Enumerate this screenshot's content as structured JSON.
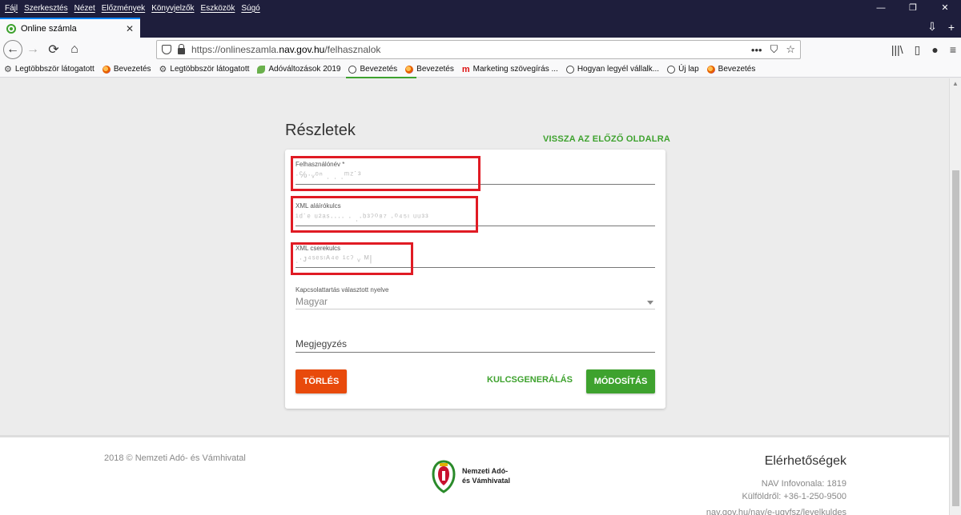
{
  "menu": {
    "items": [
      "Fájl",
      "Szerkesztés",
      "Nézet",
      "Előzmények",
      "Könyvjelzők",
      "Eszközök",
      "Súgó"
    ]
  },
  "window_controls": {
    "minimize": "—",
    "restore": "❐",
    "close": "✕"
  },
  "tab": {
    "title": "Online számla",
    "close": "✕"
  },
  "tabstrip_actions": {
    "overflow": "⇩",
    "new_tab": "+"
  },
  "nav": {
    "back": "←",
    "forward": "→",
    "reload": "⟳",
    "home": "⌂",
    "url_prefix": "https://onlineszamla.",
    "url_host": "nav.gov.hu",
    "url_path": "/felhasznalok",
    "url_more": "•••",
    "url_pocket": "⛉",
    "url_star": "☆",
    "library": "|||\\",
    "sidebar": "▯",
    "account": "●",
    "menu": "≡"
  },
  "bookmarks": [
    {
      "label": "Legtöbbször látogatott",
      "icon": "gear-icon"
    },
    {
      "label": "Bevezetés",
      "icon": "firefox-icon"
    },
    {
      "label": "Legtöbbször látogatott",
      "icon": "gear-icon"
    },
    {
      "label": "Adóváltozások 2019",
      "icon": "leaf-icon"
    },
    {
      "label": "Bevezetés",
      "icon": "globe-icon"
    },
    {
      "label": "Bevezetés",
      "icon": "firefox-icon"
    },
    {
      "label": "Marketing szövegírás ...",
      "icon": "m-icon"
    },
    {
      "label": "Hogyan legyél vállalk...",
      "icon": "globe-icon"
    },
    {
      "label": "Új lap",
      "icon": "globe-icon"
    },
    {
      "label": "Bevezetés",
      "icon": "firefox-icon"
    }
  ],
  "page": {
    "title": "Részletek",
    "back_link": "VISSZA AZ ELŐZŐ OLDALRA"
  },
  "form": {
    "username": {
      "label": "Felhasználónév *",
      "value": "·℅·ᵥᵒⁿ ˌ ˌ ˌᵐᶻ˙³"
    },
    "xml_sign_key": {
      "label": "XML aláírókulcs",
      "value": "¹ᵈ˙ᵉ ᵘ²ᵃˢ···· · ˌ·ᵇ³ˀ⁰⁸⁷ ·⁰⁴⁵ᶦ ᵘᵘ³³"
    },
    "xml_exchange_key": {
      "label": "XML cserekulcs",
      "value": "ˌ·ᴊ⁴ˢᵉˢᶦᴬ⁴ᵉ ¹ᶜˀ ᵥ ᴹ|"
    },
    "language": {
      "label": "Kapcsolattartás választott nyelve",
      "value": "Magyar"
    },
    "comment": {
      "placeholder": "Megjegyzés"
    }
  },
  "buttons": {
    "delete": "TÖRLÉS",
    "keygen": "KULCSGENERÁLÁS",
    "modify": "MÓDOSÍTÁS"
  },
  "footer": {
    "copyright": "2018 © Nemzeti Adó- és Vámhivatal",
    "logo_line1": "Nemzeti Adó-",
    "logo_line2": "és Vámhivatal",
    "contacts_title": "Elérhetőségek",
    "infoline": "NAV Infovonala: 1819",
    "abroad": "Külföldről: +36-1-250-9500",
    "link": "nav.gov.hu/nav/e-ugyfsz/levelkuldes"
  },
  "colors": {
    "accent_green": "#3ea22e",
    "delete_orange": "#e84a0c",
    "highlight_red": "#e01b24",
    "chrome_dark": "#1e1e3c"
  }
}
